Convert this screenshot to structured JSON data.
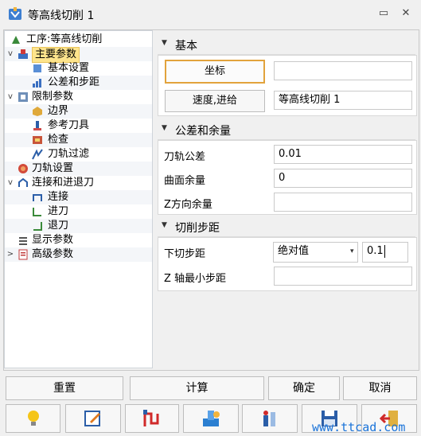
{
  "window": {
    "title": "等高线切削 1"
  },
  "tree": {
    "items": [
      {
        "label": "工序:等高线切削",
        "level": 0,
        "expander": "",
        "icon": "operation-icon"
      },
      {
        "label": "主要参数",
        "level": 0,
        "expander": "v",
        "icon": "main-params-icon",
        "selected": true
      },
      {
        "label": "基本设置",
        "level": 1,
        "expander": "",
        "icon": "basic-settings-icon"
      },
      {
        "label": "公差和步距",
        "level": 1,
        "expander": "",
        "icon": "tolerance-icon"
      },
      {
        "label": "限制参数",
        "level": 0,
        "expander": "v",
        "icon": "limit-params-icon"
      },
      {
        "label": "边界",
        "level": 1,
        "expander": "",
        "icon": "boundary-icon"
      },
      {
        "label": "参考刀具",
        "level": 1,
        "expander": "",
        "icon": "reference-tool-icon"
      },
      {
        "label": "检查",
        "level": 1,
        "expander": "",
        "icon": "check-icon"
      },
      {
        "label": "刀轨过滤",
        "level": 1,
        "expander": "",
        "icon": "toolpath-filter-icon"
      },
      {
        "label": "刀轨设置",
        "level": 0,
        "expander": "",
        "icon": "toolpath-settings-icon"
      },
      {
        "label": "连接和进退刀",
        "level": 0,
        "expander": "v",
        "icon": "link-lead-icon"
      },
      {
        "label": "连接",
        "level": 1,
        "expander": "",
        "icon": "link-icon"
      },
      {
        "label": "进刀",
        "level": 1,
        "expander": "",
        "icon": "lead-in-icon"
      },
      {
        "label": "退刀",
        "level": 1,
        "expander": "",
        "icon": "lead-out-icon"
      },
      {
        "label": "显示参数",
        "level": 0,
        "expander": "",
        "icon": "display-params-icon"
      },
      {
        "label": "高级参数",
        "level": 0,
        "expander": ">",
        "icon": "advanced-params-icon"
      }
    ]
  },
  "basic": {
    "title": "基本",
    "coord_button": "坐标",
    "coord_value": "",
    "feed_button": "速度,进给",
    "name_value": "等高线切削 1"
  },
  "tolerance": {
    "title": "公差和余量",
    "rows": [
      {
        "label": "刀轨公差",
        "value": "0.01"
      },
      {
        "label": "曲面余量",
        "value": "0"
      },
      {
        "label": "Z方向余量",
        "value": ""
      }
    ]
  },
  "stepover": {
    "title": "切削步距",
    "down_label": "下切步距",
    "down_mode": "绝对值",
    "down_value": "0.1",
    "min_label": "Z 轴最小步距",
    "min_value": ""
  },
  "footer": {
    "reset": "重置",
    "calculate": "计算",
    "ok": "确定",
    "cancel": "取消"
  },
  "icons": [
    "hint-icon",
    "edit-icon",
    "toolpath-icon",
    "simulate-icon",
    "parameters-icon",
    "save-icon",
    "exit-icon"
  ],
  "watermark": "www.ttcad.com",
  "colors": {
    "selection": "#fde48c",
    "accent": "#e2a33c",
    "watermark": "#1a73d9"
  }
}
